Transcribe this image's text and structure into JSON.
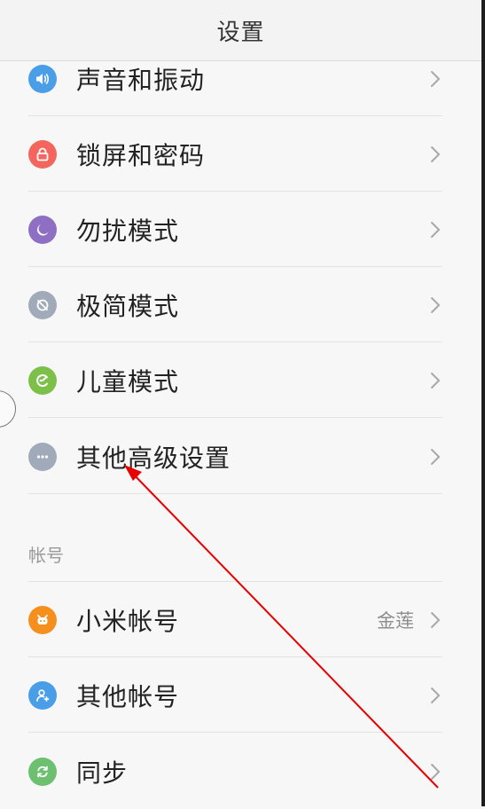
{
  "header": {
    "title": "设置"
  },
  "rows": [
    {
      "label": "声音和振动",
      "value": "",
      "icon": "speaker-icon",
      "color": "#4a9ee8"
    },
    {
      "label": "锁屏和密码",
      "value": "",
      "icon": "lock-icon",
      "color": "#f4665d"
    },
    {
      "label": "勿扰模式",
      "value": "",
      "icon": "moon-icon",
      "color": "#8e6fc4"
    },
    {
      "label": "极简模式",
      "value": "",
      "icon": "simple-mode-icon",
      "color": "#a0aab8"
    },
    {
      "label": "儿童模式",
      "value": "",
      "icon": "kid-mode-icon",
      "color": "#7cc04a"
    },
    {
      "label": "其他高级设置",
      "value": "",
      "icon": "more-dots-icon",
      "color": "#a0aab8"
    }
  ],
  "account_section": {
    "title": "帐号",
    "rows": [
      {
        "label": "小米帐号",
        "value": "金莲",
        "icon": "mi-account-icon",
        "color": "#f5901e"
      },
      {
        "label": "其他帐号",
        "value": "",
        "icon": "user-add-icon",
        "color": "#4a9ee8"
      },
      {
        "label": "同步",
        "value": "",
        "icon": "sync-icon",
        "color": "#6cc070"
      }
    ]
  },
  "annotation": {
    "arrow_color": "#e60000"
  }
}
